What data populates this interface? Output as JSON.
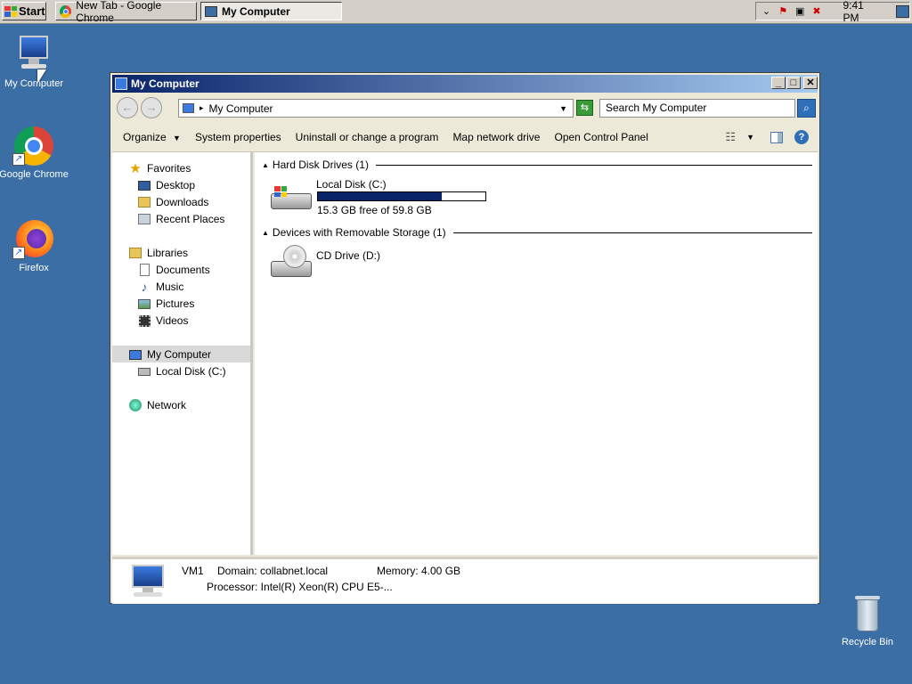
{
  "taskbar": {
    "start_label": "Start",
    "tasks": [
      {
        "label": "New Tab - Google Chrome"
      },
      {
        "label": "My Computer"
      }
    ],
    "clock": "9:41 PM"
  },
  "desktop_icons": [
    {
      "label": "My Computer"
    },
    {
      "label": "Google Chrome"
    },
    {
      "label": "Firefox"
    },
    {
      "label": "Recycle Bin"
    }
  ],
  "window": {
    "title": "My Computer",
    "address": "My Computer",
    "search_placeholder": "Search My Computer",
    "commands": [
      {
        "label": "Organize"
      },
      {
        "label": "System properties"
      },
      {
        "label": "Uninstall or change a program"
      },
      {
        "label": "Map network drive"
      },
      {
        "label": "Open Control Panel"
      }
    ],
    "nav": {
      "favorites": "Favorites",
      "desktop": "Desktop",
      "downloads": "Downloads",
      "recent": "Recent Places",
      "libraries": "Libraries",
      "documents": "Documents",
      "music": "Music",
      "pictures": "Pictures",
      "videos": "Videos",
      "my_computer": "My Computer",
      "local_disk": "Local Disk (C:)",
      "network": "Network"
    },
    "groups": {
      "hard_disk": "Hard Disk Drives (1)",
      "removable": "Devices with Removable Storage (1)"
    },
    "drives": {
      "c_name": "Local Disk (C:)",
      "c_free": "15.3 GB free of 59.8 GB",
      "c_used_fraction": 0.74,
      "d_name": "CD Drive (D:)"
    },
    "details": {
      "name": "VM1",
      "domain": "Domain: collabnet.local",
      "memory": "Memory: 4.00 GB",
      "processor": "Processor: Intel(R) Xeon(R) CPU E5-..."
    }
  },
  "colors": {
    "desktop_bg": "#3a6ea5",
    "title_gradient_start": "#0a246a",
    "usage_bar": "#0a246a"
  }
}
